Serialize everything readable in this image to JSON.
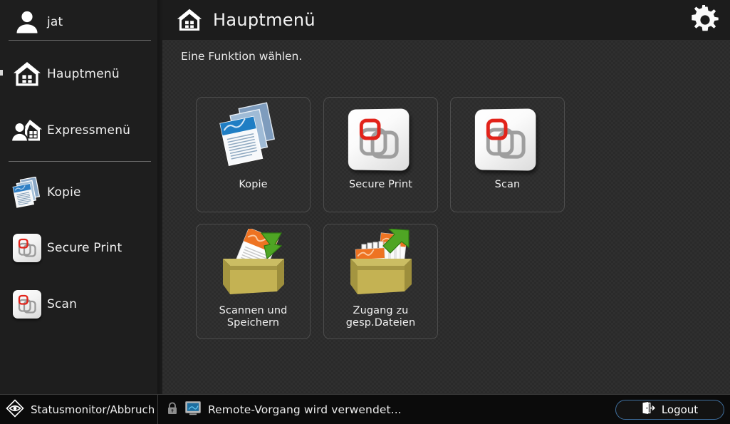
{
  "sidebar": {
    "user": {
      "label": "jat",
      "icon": "user-icon"
    },
    "items": [
      {
        "label": "Hauptmenü",
        "icon": "home-icon"
      },
      {
        "label": "Expressmenü",
        "icon": "express-menu-icon"
      },
      {
        "label": "Kopie",
        "icon": "copy-documents-icon"
      },
      {
        "label": "Secure Print",
        "icon": "secure-print-icon"
      },
      {
        "label": "Scan",
        "icon": "scan-icon"
      }
    ],
    "status_monitor": {
      "label": "Statusmonitor/Abbruch",
      "icon": "status-monitor-icon"
    }
  },
  "header": {
    "title": "Hauptmenü",
    "home_icon": "home-icon",
    "settings_icon": "gear-icon"
  },
  "main": {
    "subtitle": "Eine Funktion wählen.",
    "tiles": [
      {
        "label": "Kopie",
        "icon": "copy-documents-icon"
      },
      {
        "label": "Secure Print",
        "icon": "secure-print-icon"
      },
      {
        "label": "Scan",
        "icon": "scan-icon"
      },
      {
        "label": "Scannen und\nSpeichern",
        "line1": "Scannen und",
        "line2": "Speichern",
        "icon": "scan-and-store-icon"
      },
      {
        "label": "Zugang zu\ngesp.Dateien",
        "line1": "Zugang zu",
        "line2": "gesp.Dateien",
        "icon": "access-stored-files-icon"
      }
    ]
  },
  "statusbar": {
    "lock_icon": "lock-icon",
    "remote_icon": "remote-monitor-icon",
    "message": "Remote-Vorgang wird verwendet...",
    "logout": {
      "label": "Logout",
      "icon": "logout-door-icon"
    }
  },
  "colors": {
    "sidebar_bg": "#1e1e1e",
    "main_bg": "#2a2a2a",
    "topbar_bg": "#1c1c1c",
    "statusbar_bg": "#0b0b0b",
    "accent_red": "#e2231a",
    "logout_border": "#3f6f9e",
    "text": "#f2f2f2"
  }
}
